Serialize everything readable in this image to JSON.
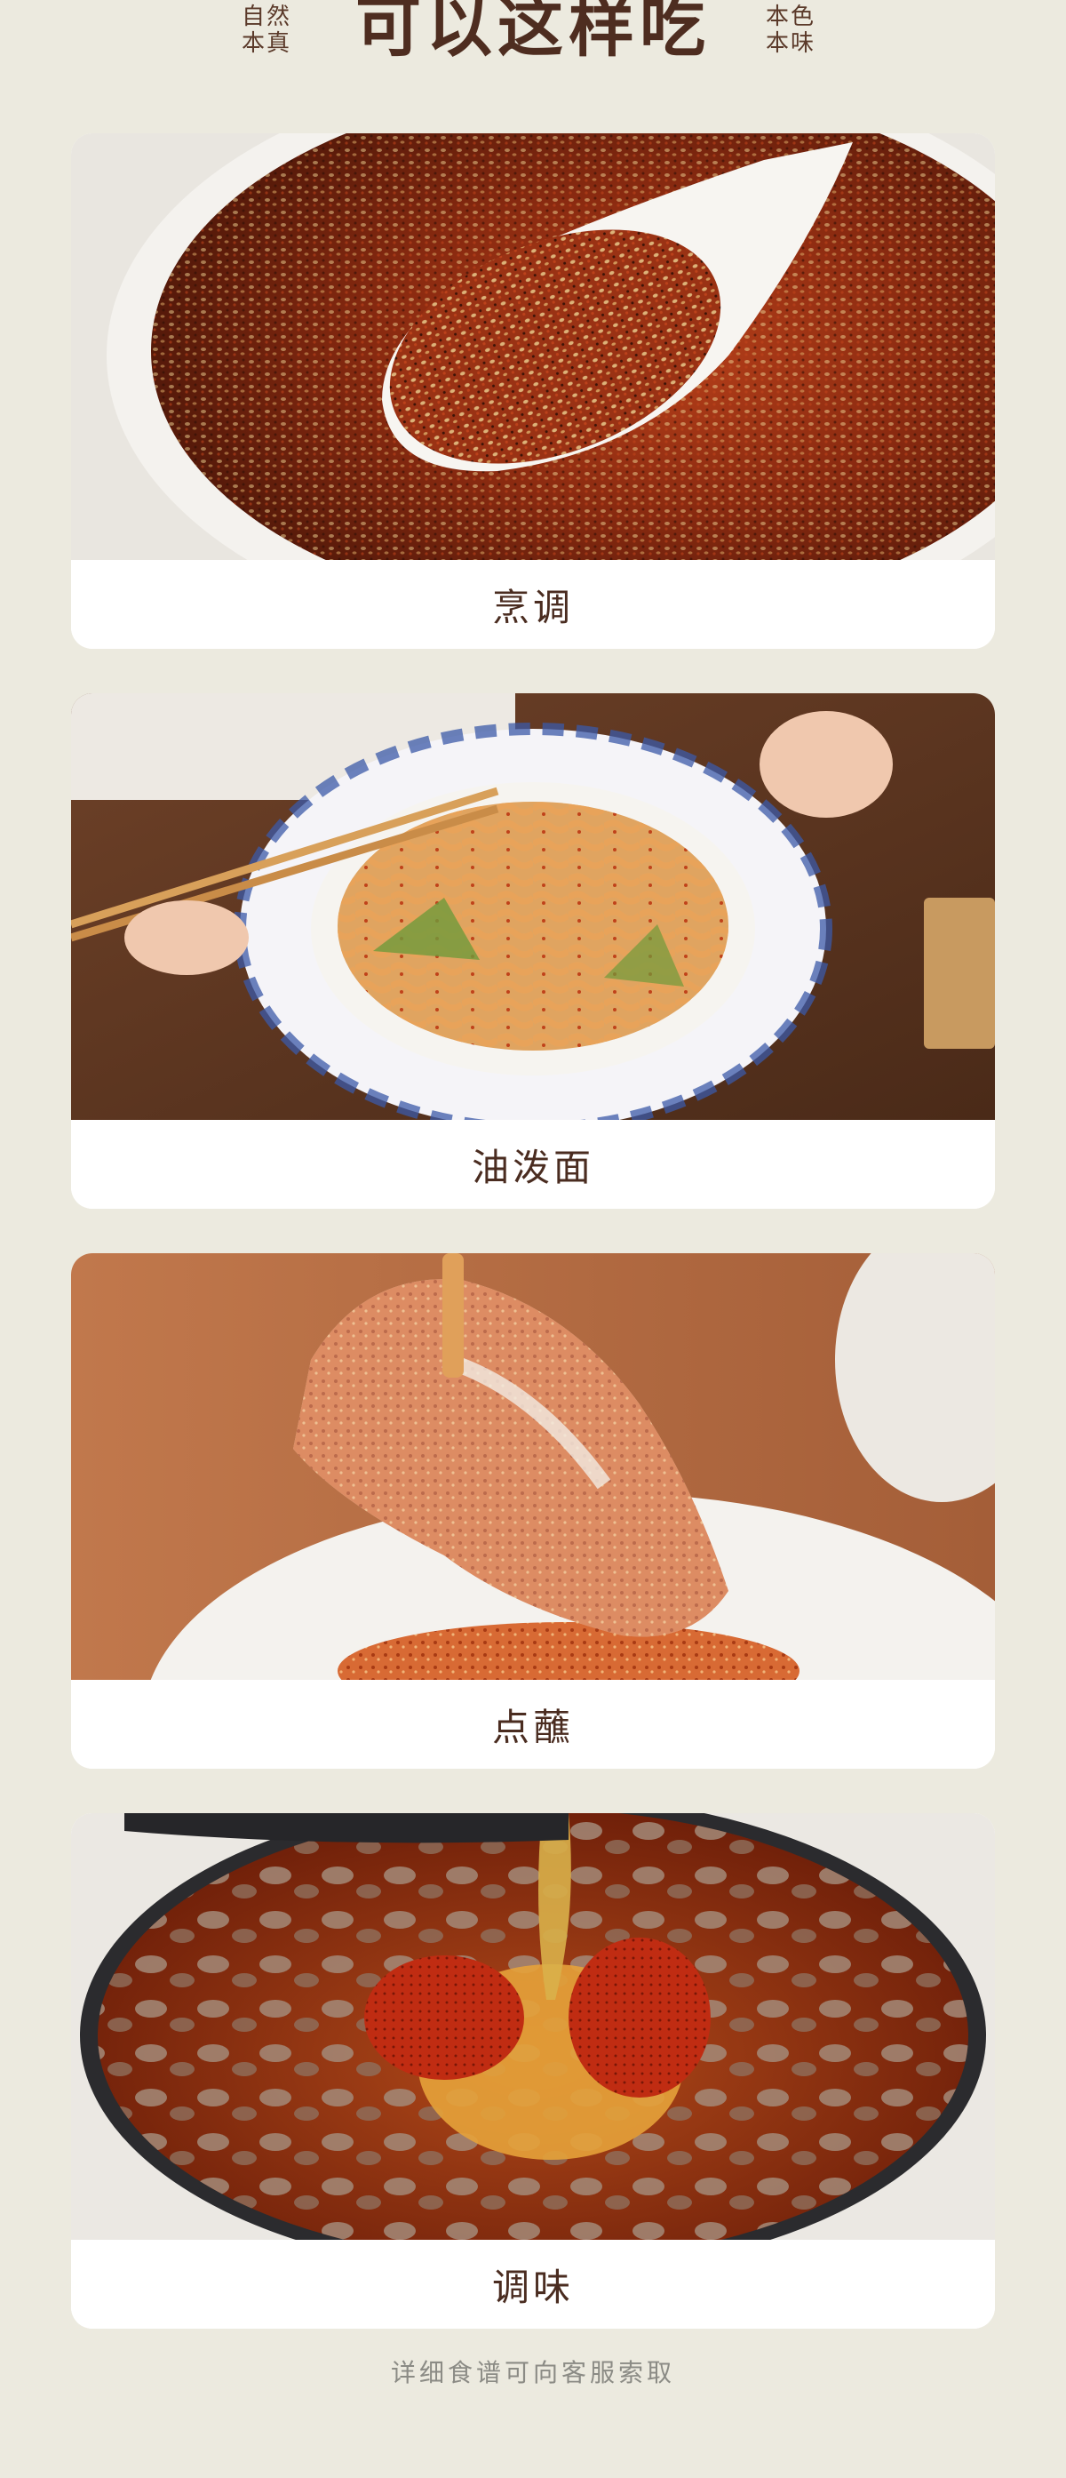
{
  "header": {
    "left_tag": [
      "自然",
      "本真"
    ],
    "title": "可以这样吃",
    "right_tag": [
      "本色",
      "本味"
    ]
  },
  "cards": [
    {
      "caption": "烹调",
      "image": "chili-oil-spoon"
    },
    {
      "caption": "油泼面",
      "image": "oil-splashed-noodles"
    },
    {
      "caption": "点蘸",
      "image": "dipped-pork-slice"
    },
    {
      "caption": "调味",
      "image": "stew-seasoning"
    }
  ],
  "footer": {
    "note": "详细食谱可向客服索取"
  },
  "colors": {
    "background": "#eceadf",
    "text": "#4a2c20",
    "card": "#ffffff",
    "note": "#8b8b85"
  }
}
